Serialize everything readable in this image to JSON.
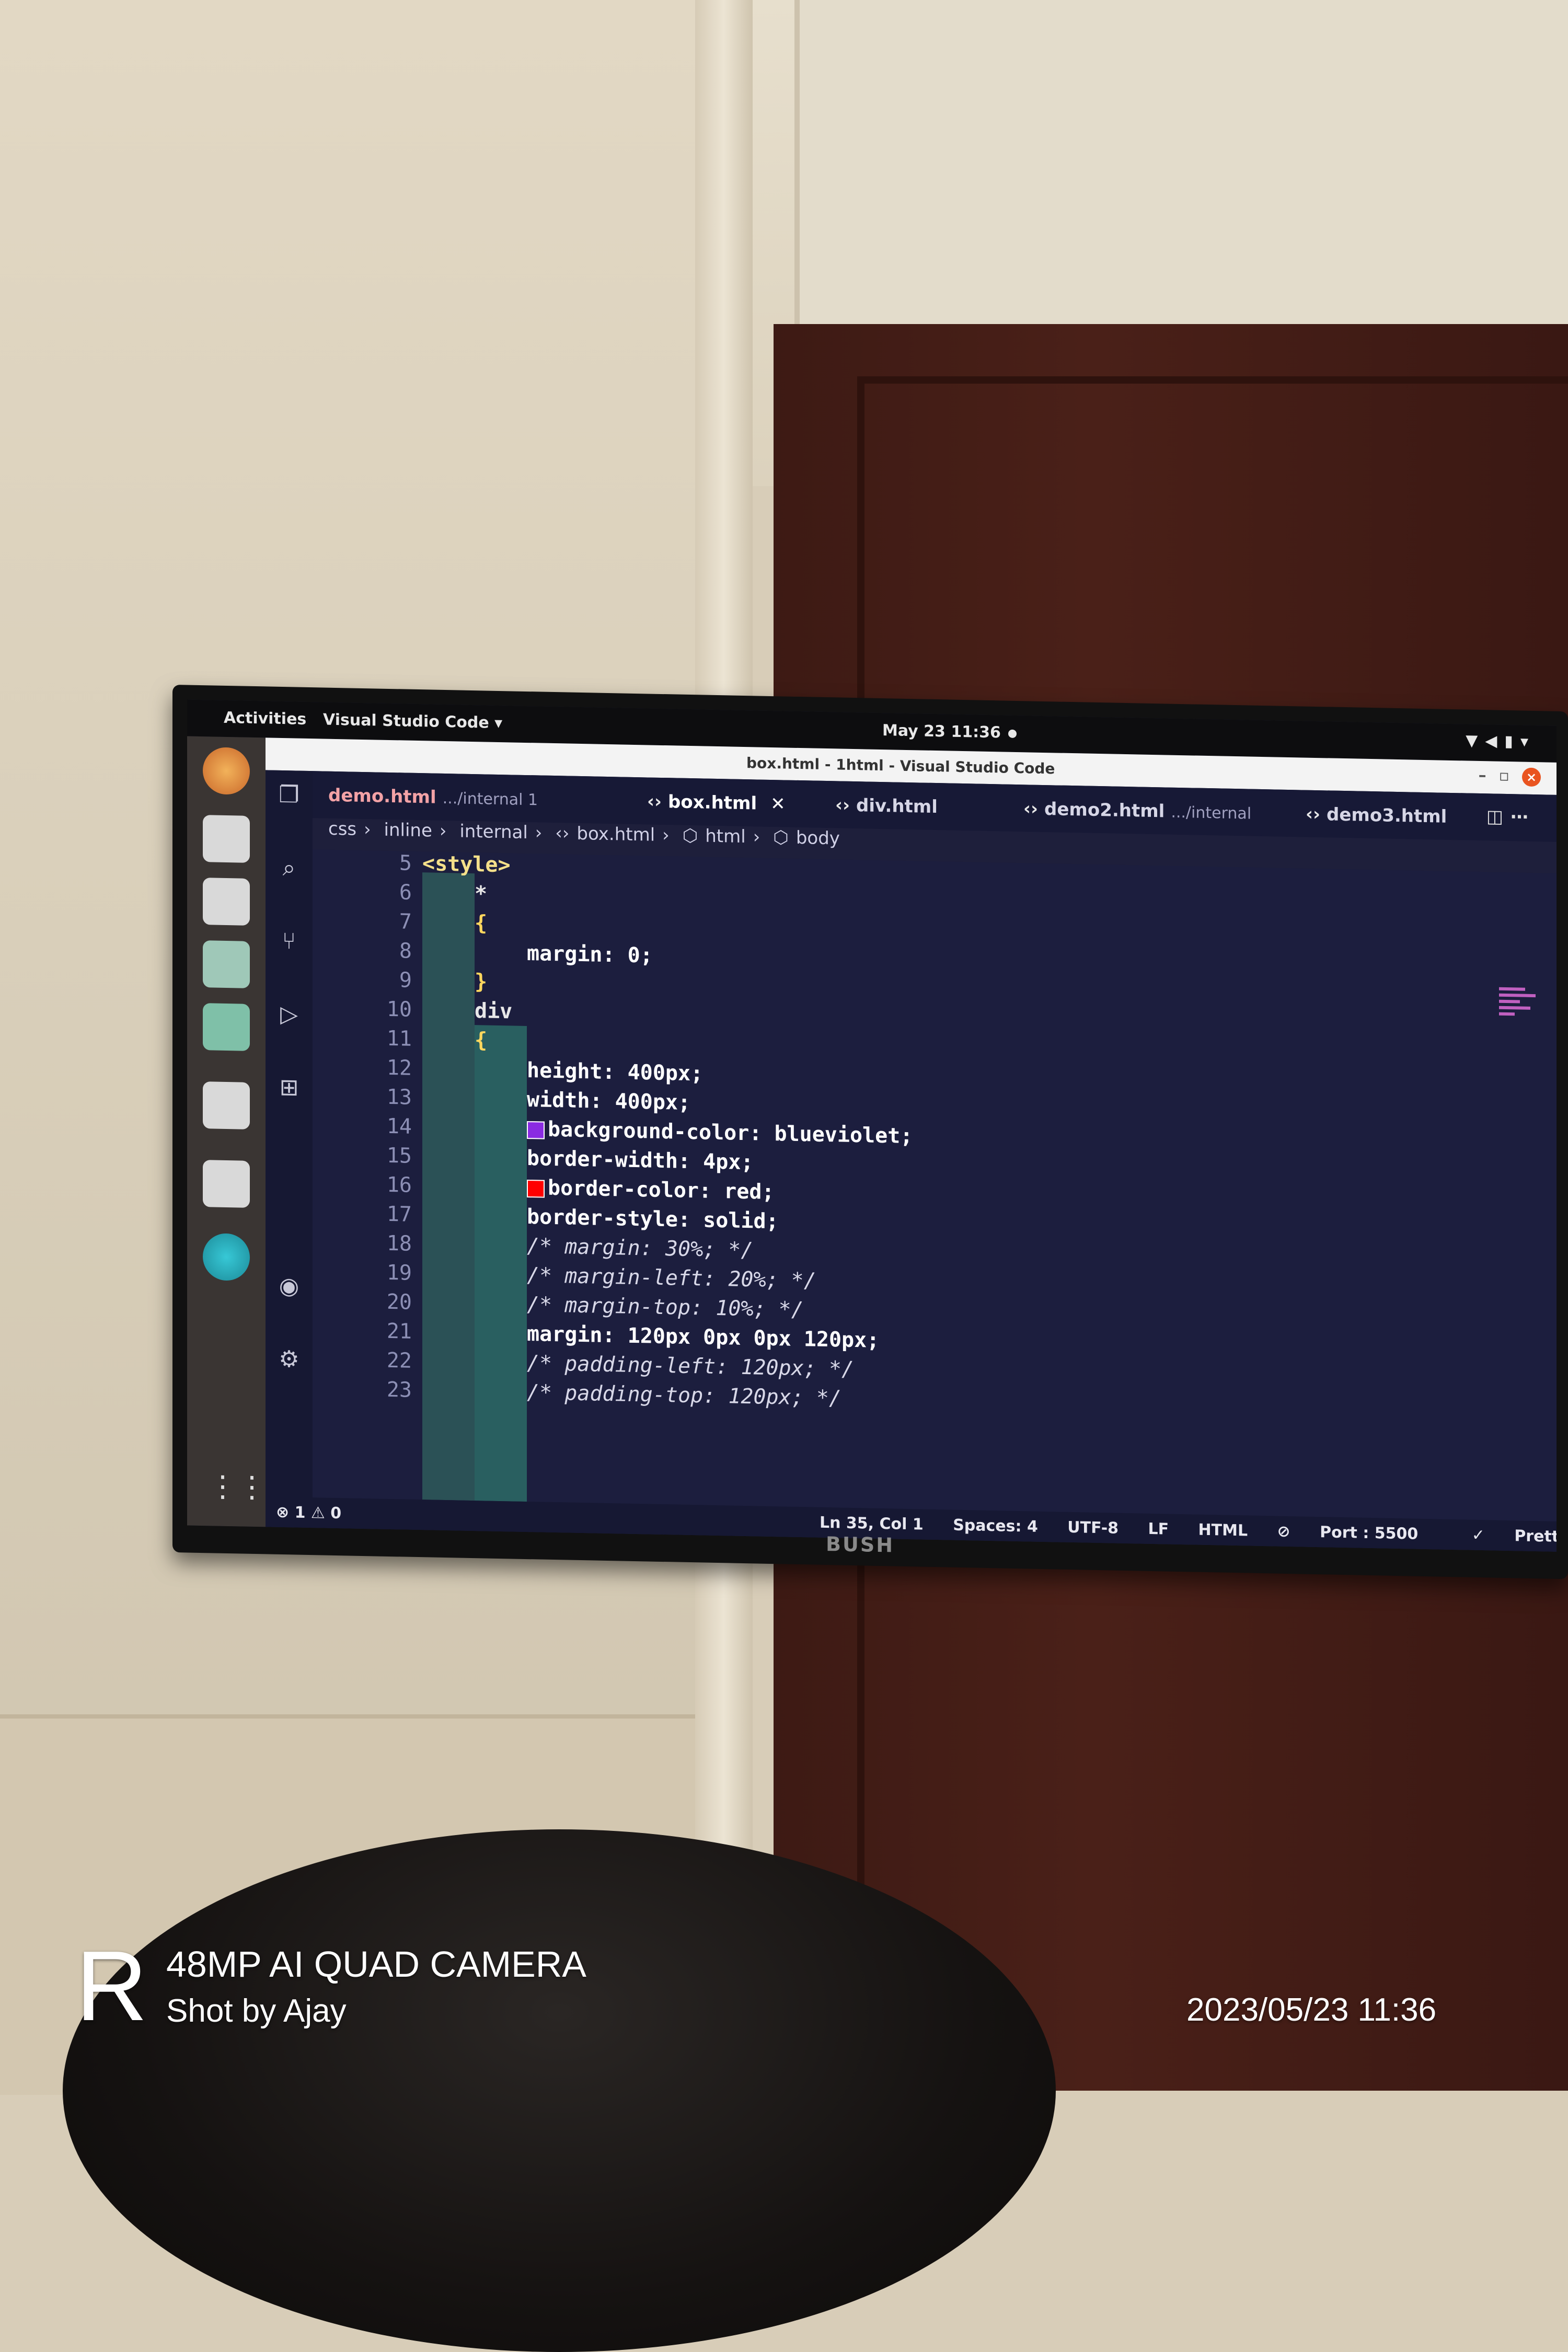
{
  "topbar": {
    "activities": "Activities",
    "app_menu": "Visual Studio Code ▾",
    "clock": "May 23  11:36",
    "tray_icons": [
      "wifi-icon",
      "volume-icon",
      "battery-icon",
      "power-menu-icon"
    ]
  },
  "window": {
    "title": "box.html - 1html - Visual Studio Code"
  },
  "tabs": [
    {
      "label": "demo.html",
      "sub": ".../internal 1",
      "state": "modified"
    },
    {
      "label": "box.html",
      "sub": "",
      "state": "active"
    },
    {
      "label": "div.html",
      "sub": "",
      "state": "normal"
    },
    {
      "label": "demo2.html",
      "sub": ".../internal",
      "state": "normal"
    },
    {
      "label": "demo3.html",
      "sub": "",
      "state": "normal"
    }
  ],
  "breadcrumb": [
    "css",
    "inline",
    "internal",
    "box.html",
    "html",
    "body"
  ],
  "editor": {
    "lines": [
      {
        "n": "5",
        "text": "<style>"
      },
      {
        "n": "6",
        "text": "*"
      },
      {
        "n": "7",
        "text": "{"
      },
      {
        "n": "8",
        "text": "margin: 0;"
      },
      {
        "n": "9",
        "text": "}"
      },
      {
        "n": "10",
        "text": "div"
      },
      {
        "n": "11",
        "text": "{"
      },
      {
        "n": "12",
        "text": "height: 400px;"
      },
      {
        "n": "13",
        "text": "width: 400px;"
      },
      {
        "n": "14",
        "text": "background-color: blueviolet;"
      },
      {
        "n": "15",
        "text": "border-width: 4px;"
      },
      {
        "n": "16",
        "text": "border-color: red;"
      },
      {
        "n": "17",
        "text": "border-style: solid;"
      },
      {
        "n": "18",
        "text": "/* margin: 30%; */"
      },
      {
        "n": "19",
        "text": "/* margin-left: 20%; */"
      },
      {
        "n": "20",
        "text": "/* margin-top: 10%; */"
      },
      {
        "n": "21",
        "text": "margin: 120px 0px 0px 120px;"
      },
      {
        "n": "22",
        "text": "/* padding-left: 120px; */"
      },
      {
        "n": "23",
        "text": "/* padding-top: 120px; */"
      }
    ],
    "colors": {
      "blueviolet": "#8a2be2",
      "red": "#ff0000"
    }
  },
  "statusbar": {
    "errors": "1",
    "warnings": "0",
    "position": "Ln 35, Col 1",
    "spaces": "Spaces: 4",
    "encoding": "UTF-8",
    "eol": "LF",
    "language": "HTML",
    "port": "Port : 5500",
    "prettier": "Prettier"
  },
  "tv_brand": "BUSH",
  "watermark": {
    "logo": "R",
    "camera": "48MP AI QUAD CAMERA",
    "shot_by": "Shot by Ajay",
    "datetime": "2023/05/23 11:36"
  }
}
